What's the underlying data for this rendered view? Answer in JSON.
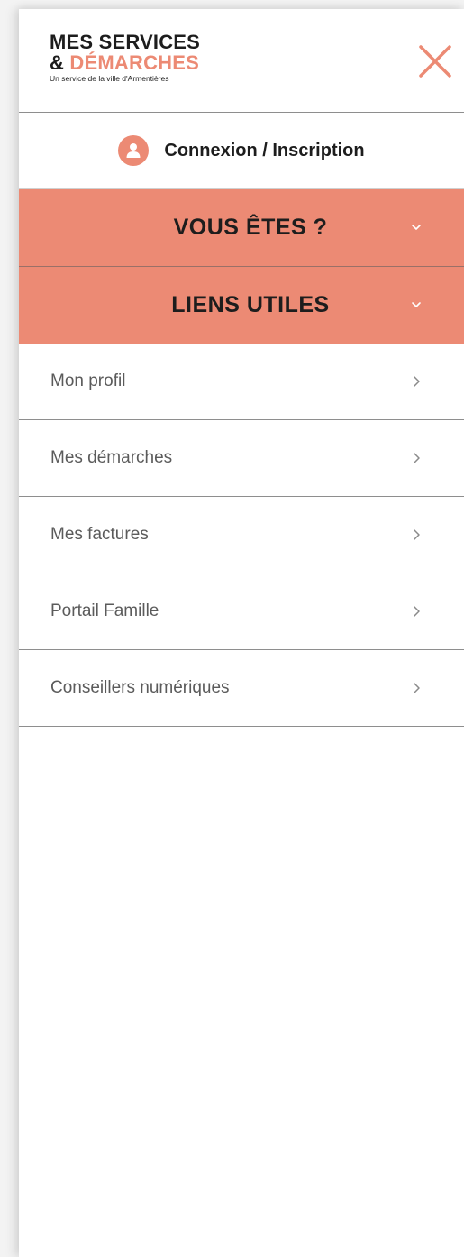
{
  "logo": {
    "line1": "MES SERVICES",
    "amp": "&",
    "accent_word": "DÉMARCHES",
    "subtitle": "Un service de la ville d'Armentières"
  },
  "header": {
    "close_icon": "close-x-icon"
  },
  "login": {
    "icon": "user-icon",
    "label": "Connexion / Inscription"
  },
  "accordions": [
    {
      "label": "VOUS ÊTES ?",
      "icon": "chevron-down-icon"
    },
    {
      "label": "LIENS UTILES",
      "icon": "chevron-down-icon"
    }
  ],
  "links": [
    {
      "label": "Mon profil",
      "icon": "chevron-right-icon"
    },
    {
      "label": "Mes démarches",
      "icon": "chevron-right-icon"
    },
    {
      "label": "Mes factures",
      "icon": "chevron-right-icon"
    },
    {
      "label": "Portail Famille",
      "icon": "chevron-right-icon"
    },
    {
      "label": "Conseillers numériques",
      "icon": "chevron-right-icon"
    }
  ],
  "colors": {
    "accent": "#ec8a74",
    "text_dark": "#1d1d1d",
    "text_muted": "#5b5b5b",
    "divider": "#8e8e8e"
  }
}
